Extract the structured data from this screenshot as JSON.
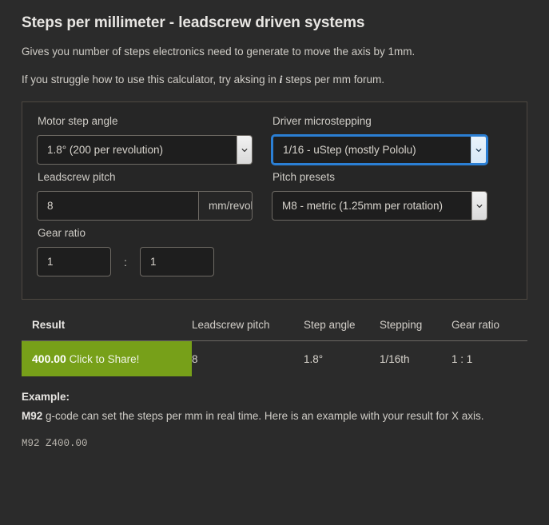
{
  "header": {
    "title": "Steps per millimeter - leadscrew driven systems",
    "intro": "Gives you number of steps electronics need to generate to move the axis by 1mm.",
    "help_before": "If you struggle how to use this calculator, try aksing in ",
    "help_icon": "i",
    "help_after": " steps per mm forum."
  },
  "form": {
    "motor_step_angle": {
      "label": "Motor step angle",
      "value": "1.8° (200 per revolution)"
    },
    "driver_microstepping": {
      "label": "Driver microstepping",
      "value": "1/16 - uStep (mostly Pololu)"
    },
    "leadscrew_pitch": {
      "label": "Leadscrew pitch",
      "value": "8",
      "placeholder": "8",
      "unit": "mm/revolution"
    },
    "pitch_presets": {
      "label": "Pitch presets",
      "value": "M8 - metric (1.25mm per rotation)"
    },
    "gear_ratio": {
      "label": "Gear ratio",
      "value_a": "1",
      "value_b": "1",
      "separator": ":"
    }
  },
  "result": {
    "headers": [
      "Result",
      "Leadscrew pitch",
      "Step angle",
      "Stepping",
      "Gear ratio"
    ],
    "value": "400.00",
    "share_label": "Click to Share!",
    "accent_color": "#77a019",
    "cells": {
      "leadscrew_pitch": "8",
      "step_angle": "1.8°",
      "stepping": "1/16th",
      "gear_ratio": "1 : 1"
    }
  },
  "example": {
    "title": "Example:",
    "gcode_name": "M92",
    "body": " g-code can set the steps per mm in real time. Here is an example with your result for X axis.",
    "code": "M92 Z400.00"
  }
}
